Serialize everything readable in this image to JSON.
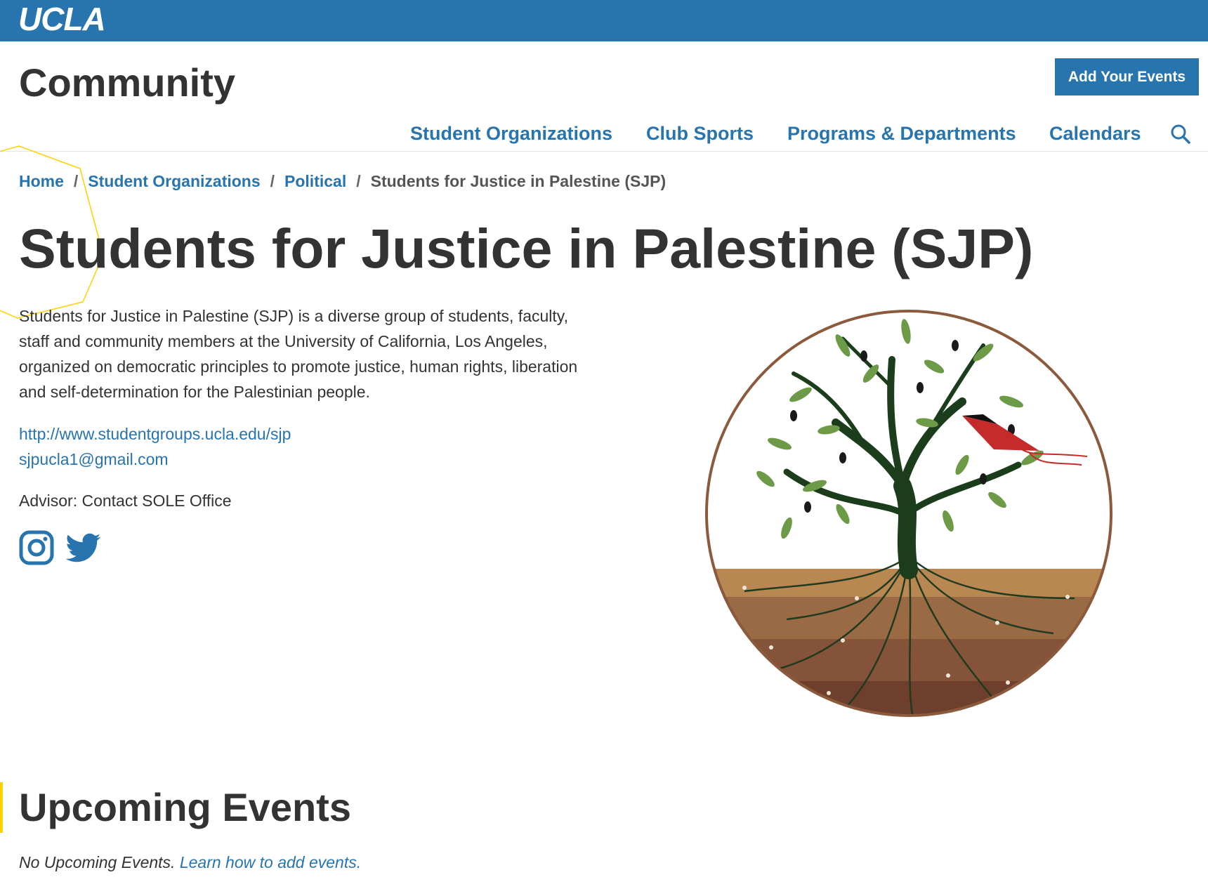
{
  "header": {
    "logo_text": "UCLA",
    "brand_color": "#2774ae",
    "accent_color": "#ffd100"
  },
  "site": {
    "title": "Community",
    "add_events_label": "Add Your Events"
  },
  "nav": {
    "items": [
      {
        "label": "Student Organizations"
      },
      {
        "label": "Club Sports"
      },
      {
        "label": "Programs & Departments"
      },
      {
        "label": "Calendars"
      }
    ],
    "search_icon": "search-icon"
  },
  "breadcrumb": {
    "items": [
      {
        "label": "Home"
      },
      {
        "label": "Student Organizations"
      },
      {
        "label": "Political"
      }
    ],
    "separator": "/",
    "current": "Students for Justice in Palestine (SJP)"
  },
  "org": {
    "name": "Students for Justice in Palestine (SJP)",
    "description": "Students for Justice in Palestine (SJP) is a diverse group of students, faculty, staff and community members at the University of California, Los Angeles, organized on democratic principles to promote justice, human rights, liberation and self-determination for the Palestinian people.",
    "website": "http://www.studentgroups.ucla.edu/sjp",
    "email": "sjpucla1@gmail.com",
    "advisor": "Advisor: Contact SOLE Office",
    "social_icons": [
      "instagram-icon",
      "twitter-icon"
    ],
    "logo_icon": "olive-tree-logo"
  },
  "events": {
    "heading": "Upcoming Events",
    "empty_text": "No Upcoming Events.",
    "learn_link": "Learn how to add events."
  }
}
